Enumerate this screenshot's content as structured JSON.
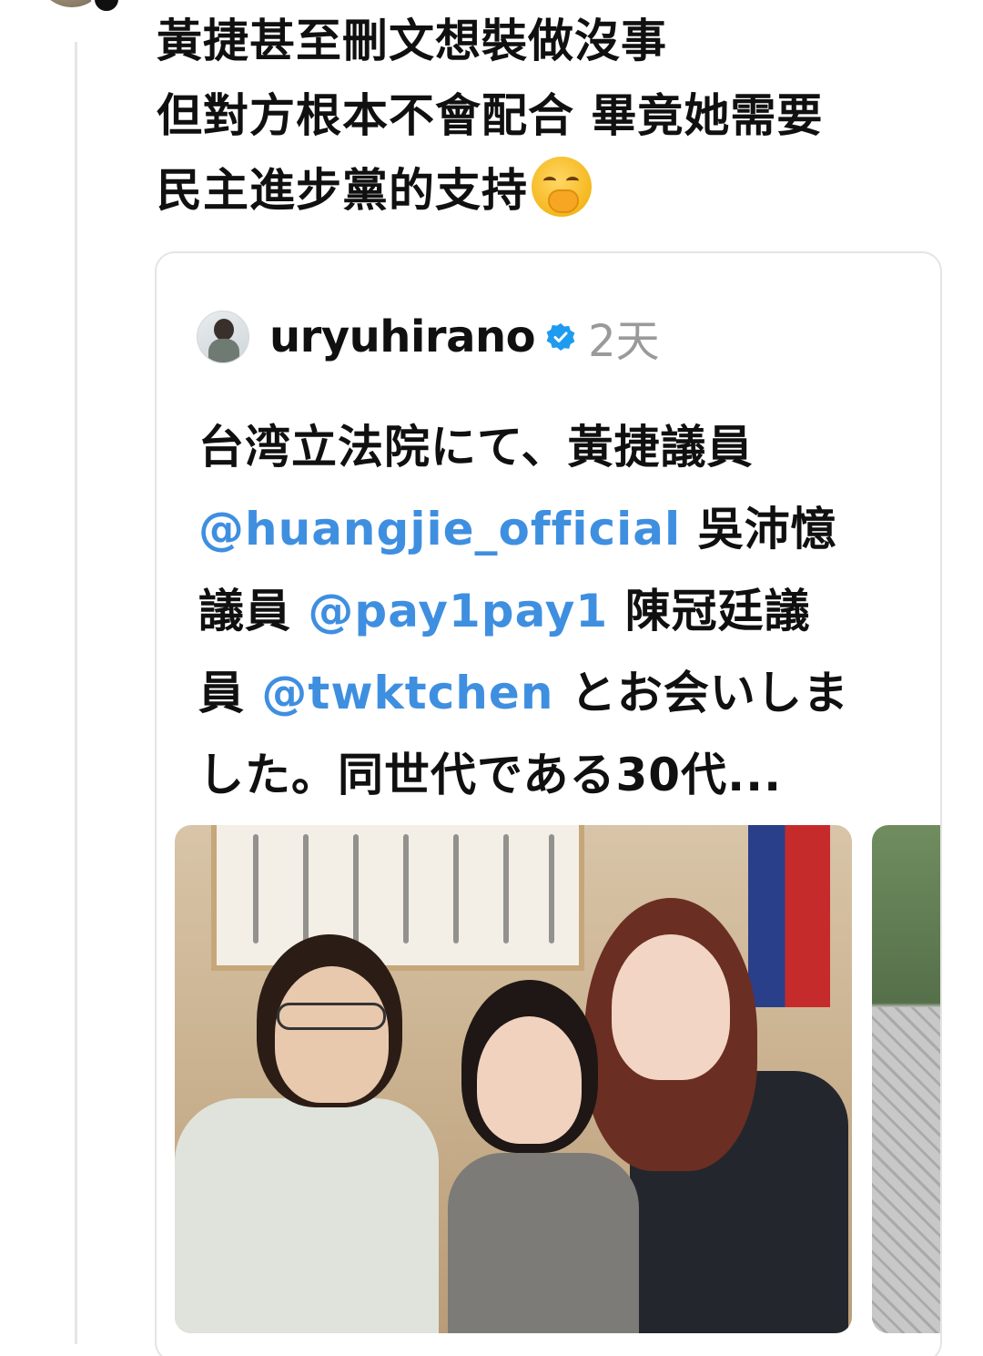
{
  "post": {
    "lines": [
      "黃捷甚至刪文想裝做沒事",
      "但對方根本不會配合 畢竟她需要",
      "民主進步黨的支持"
    ],
    "emoji": "face-with-hand-over-mouth"
  },
  "quote": {
    "username": "uryuhirano",
    "time": "2天",
    "text": {
      "l1": "台湾立法院にて、黃捷議員",
      "l2_mention": "@huangjie_official",
      "l2_text": " 吳沛憶",
      "l3_text": "議員 ",
      "l3_mention": "@pay1pay1",
      "l3_text2": " 陳冠廷議",
      "l4_text": "員 ",
      "l4_mention": "@twktchen",
      "l4_text2": " とお会いしま",
      "l5": "した。同世代である30代..."
    },
    "photos": [
      "selfie-photo",
      "next-photo-preview"
    ]
  },
  "colors": {
    "mention": "#3f8fe0",
    "verified": "#1d9bf0",
    "muted": "#9a9a9a"
  }
}
